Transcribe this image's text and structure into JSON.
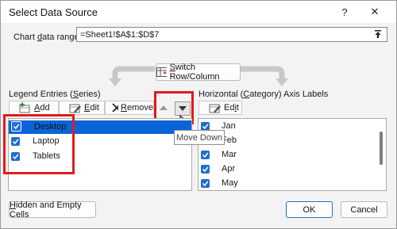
{
  "dialog": {
    "title": "Select Data Source",
    "help_label": "?",
    "close_label": "✕"
  },
  "range": {
    "label": "Chart data range:",
    "value": "=Sheet1!$A$1:$D$7"
  },
  "switch_button": "Switch Row/Column",
  "legend": {
    "title": "Legend Entries (Series)",
    "add": "Add",
    "edit": "Edit",
    "remove": "Remove",
    "items": [
      {
        "label": "Desktop",
        "checked": true,
        "selected": true
      },
      {
        "label": "Laptop",
        "checked": true,
        "selected": false
      },
      {
        "label": "Tablets",
        "checked": true,
        "selected": false
      }
    ]
  },
  "axis": {
    "title": "Horizontal (Category) Axis Labels",
    "edit": "Edit",
    "items": [
      {
        "label": "Jan",
        "checked": true
      },
      {
        "label": "Feb",
        "checked": true
      },
      {
        "label": "Mar",
        "checked": true
      },
      {
        "label": "Apr",
        "checked": true
      },
      {
        "label": "May",
        "checked": true
      }
    ]
  },
  "tooltip": "Move Down",
  "footer": {
    "hidden_cells": "Hidden and Empty Cells",
    "ok": "OK",
    "cancel": "Cancel"
  },
  "colors": {
    "accent": "#1f6fd0",
    "highlight": "#e11b1b",
    "selection": "#0a64d8"
  }
}
